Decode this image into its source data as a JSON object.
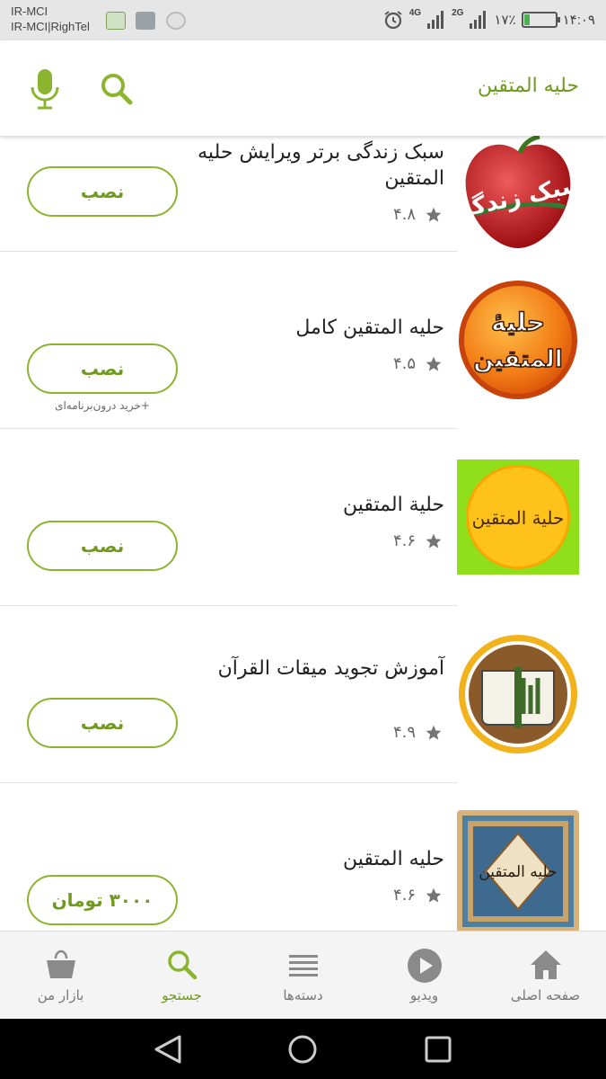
{
  "status_bar": {
    "carrier_line1": "IR-MCI",
    "carrier_line2": "IR-MCI|RighTel",
    "network_1": "4G",
    "network_2": "2G",
    "battery_text": "۱۷٪",
    "battery_level": 0.17,
    "time": "۱۴:۰۹"
  },
  "appbar": {
    "title": "حلیه المتقین",
    "search_icon": "search-icon",
    "mic_icon": "mic-icon"
  },
  "apps": [
    {
      "name": "سبک زندگی برتر ویرایش حلیه المتقین",
      "rating": "۴.۸",
      "button": "نصب",
      "note": ""
    },
    {
      "name": "حلیه المتقین کامل",
      "rating": "۴.۵",
      "button": "نصب",
      "note": "+خرید درون‌برنامه‌ای"
    },
    {
      "name": "حلیة المتقین",
      "rating": "۴.۶",
      "button": "نصب",
      "note": ""
    },
    {
      "name": "آموزش تجوید میقات القرآن",
      "rating": "۴.۹",
      "button": "نصب",
      "note": ""
    },
    {
      "name": "حلیه المتقین",
      "rating": "۴.۶",
      "button": "۳۰۰۰ تومان",
      "note": ""
    }
  ],
  "app_icon_texts": {
    "icon1": "سبک زندگی",
    "icon2_line1": "حلیهٔ",
    "icon2_line2": "المتقین",
    "icon3": "حلیة المتقین",
    "icon5": "حلیه المتقین"
  },
  "bottom_nav": [
    {
      "label": "بازار من",
      "icon": "bag-icon"
    },
    {
      "label": "جستجو",
      "icon": "search-icon",
      "active": true
    },
    {
      "label": "دسته‌ها",
      "icon": "list-icon"
    },
    {
      "label": "ویدیو",
      "icon": "play-icon"
    },
    {
      "label": "صفحه اصلی",
      "icon": "home-icon"
    }
  ],
  "colors": {
    "accent": "#6f9a1e",
    "button_border": "#8bb42f",
    "nav_inactive": "#777777"
  }
}
